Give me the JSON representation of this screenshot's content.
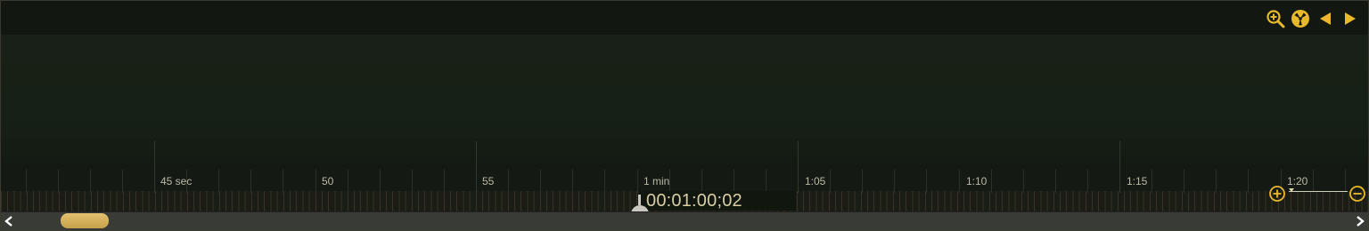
{
  "timeline": {
    "labels": [
      "45 sec",
      "50",
      "55",
      "1 min",
      "1:05",
      "1:10",
      "1:15",
      "1:20"
    ],
    "timecode": "00:01:00;02",
    "zoom_level": 0.0
  },
  "toolbar": {
    "items": [
      {
        "name": "zoom-magnifier-icon"
      },
      {
        "name": "radiation-icon"
      },
      {
        "name": "previous-arrow-icon"
      },
      {
        "name": "next-arrow-icon"
      }
    ]
  },
  "scrollbar": {
    "position": 0.05
  },
  "colors": {
    "accent": "#e8b92b",
    "background": "#161c15",
    "timecode": "#d8cda3",
    "scroll_thumb": "#d4b25a"
  }
}
